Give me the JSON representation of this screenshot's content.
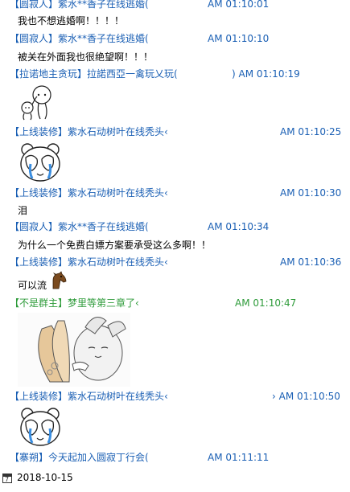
{
  "messages": [
    {
      "name": "【圆寂人】紫水**香子在线逃婚(",
      "time": "AM 01:10:01",
      "text": "我也不想逃婚啊！！！！"
    },
    {
      "name": "【圆寂人】紫水**香子在线逃婚(",
      "time": "AM 01:10:10",
      "text": "被关在外面我也很绝望啊！！！"
    },
    {
      "name": "【拉诺地主贪玩】拉諾西亞一禽玩乂玩(",
      "time2": ") AM 01:10:19",
      "sticker": "pat-head-sticker"
    },
    {
      "name": "【上线装修】紫水石动树叶在线秃头‹",
      "time": "AM 01:10:25",
      "sticker": "crying-bear-sticker"
    },
    {
      "name": "【上线装修】紫水石动树叶在线秃头‹",
      "time": "AM 01:10:30",
      "text": "泪"
    },
    {
      "name": "【圆寂人】紫水**香子在线逃婚(",
      "time": "AM 01:10:34",
      "text": "为什么一个免费白嫖方案要承受这么多啊！！"
    },
    {
      "name": "【上线装修】紫水石动树叶在线秃头‹",
      "time": "AM 01:10:36",
      "text": "可以流"
    },
    {
      "name": "【不是群主】梦里等第三章了‹",
      "time": "AM 01:10:47",
      "sticker": "bunny-sticker"
    },
    {
      "name": "【上线装修】紫水石动树叶在线秃头‹",
      "time": "› AM 01:10:50",
      "sticker": "crying-bear-sticker"
    },
    {
      "name": "【寨朔】今天起加入圆寂丁行会(",
      "time": "AM 01:11:11"
    }
  ],
  "footer": {
    "calendar_day": "7",
    "date": "2018-10-15"
  },
  "colors": {
    "name_blue": "#1a5fb4",
    "name_green": "#2e9b3a"
  }
}
